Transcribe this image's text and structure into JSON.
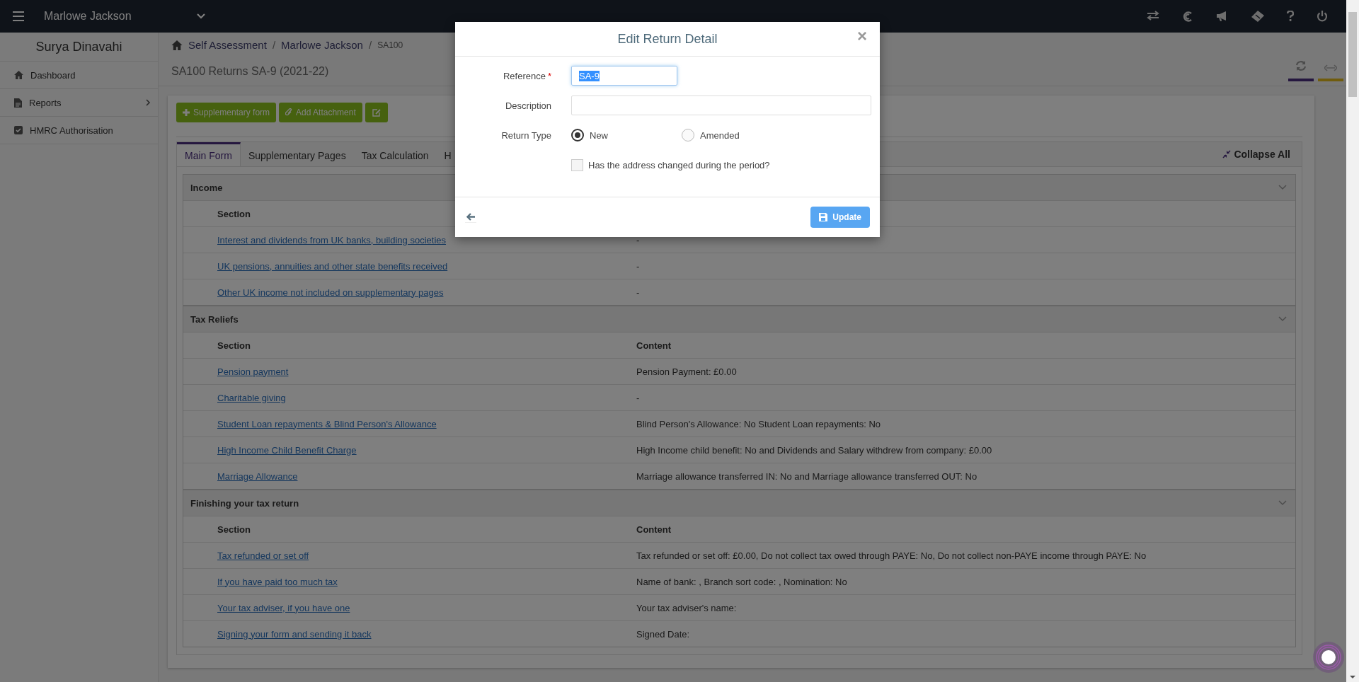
{
  "topbar": {
    "client": "Marlowe Jackson"
  },
  "sidebar": {
    "user": "Surya Dinavahi",
    "items": [
      {
        "label": "Dashboard",
        "expandable": false
      },
      {
        "label": "Reports",
        "expandable": true
      },
      {
        "label": "HMRC Authorisation",
        "expandable": false
      }
    ]
  },
  "breadcrumb": [
    "Self Assessment",
    "Marlowe Jackson",
    "SA100"
  ],
  "breadcrumb_separator": "/",
  "page_title": "SA100 Returns SA-9 (2021-22)",
  "toolbar": [
    "Supplementary form",
    "Add Attachment"
  ],
  "tabs": [
    {
      "label": "Main Form",
      "selected": true
    },
    {
      "label": "Supplementary Pages",
      "selected": false
    },
    {
      "label": "Tax Calculation",
      "selected": false
    },
    {
      "label": "H",
      "selected": false
    }
  ],
  "collapse_all": "Collapse All",
  "sections": [
    {
      "title": "Income",
      "columns": [
        "Section"
      ],
      "rows": [
        {
          "section": "Interest and dividends from UK banks, building societies",
          "content": "-"
        },
        {
          "section": "UK pensions, annuities and other state benefits received",
          "content": "-"
        },
        {
          "section": "Other UK income not included on supplementary pages",
          "content": "-"
        }
      ]
    },
    {
      "title": "Tax Reliefs",
      "columns": [
        "Section",
        "Content"
      ],
      "rows": [
        {
          "section": "Pension payment",
          "content": "Pension Payment: £0.00"
        },
        {
          "section": "Charitable giving",
          "content": "-"
        },
        {
          "section": "Student Loan repayments & Blind Person's Allowance",
          "content": "Blind Person's Allowance: No Student Loan repayments: No"
        },
        {
          "section": "High Income Child Benefit Charge",
          "content": "High Income child benefit: No and Dividends and Salary withdrew from company: £0.00"
        },
        {
          "section": "Marriage Allowance",
          "content": "Marriage allowance transferred IN: No and Marriage allowance transferred OUT: No"
        }
      ]
    },
    {
      "title": "Finishing your tax return",
      "columns": [
        "Section",
        "Content"
      ],
      "rows": [
        {
          "section": "Tax refunded or set off",
          "content": "Tax refunded or set off: £0.00, Do not collect tax owed through PAYE: No, Do not collect non-PAYE income through PAYE: No"
        },
        {
          "section": "If you have paid too much tax",
          "content": "Name of bank: , Branch sort code: , Nomination: No"
        },
        {
          "section": "Your tax adviser, if you have one",
          "content": "Your tax adviser's name:"
        },
        {
          "section": "Signing your form and sending it back",
          "content": "Signed Date:"
        }
      ]
    }
  ],
  "modal": {
    "title": "Edit Return Detail",
    "reference_label": "Reference",
    "required_mark": "*",
    "reference_value": "SA-9",
    "description_label": "Description",
    "return_type_label": "Return Type",
    "return_types": [
      {
        "label": "New",
        "selected": true
      },
      {
        "label": "Amended",
        "selected": false
      }
    ],
    "address_changed": {
      "label": "Has the address changed during the period?",
      "checked": false
    },
    "close": "×",
    "update": "Update"
  }
}
